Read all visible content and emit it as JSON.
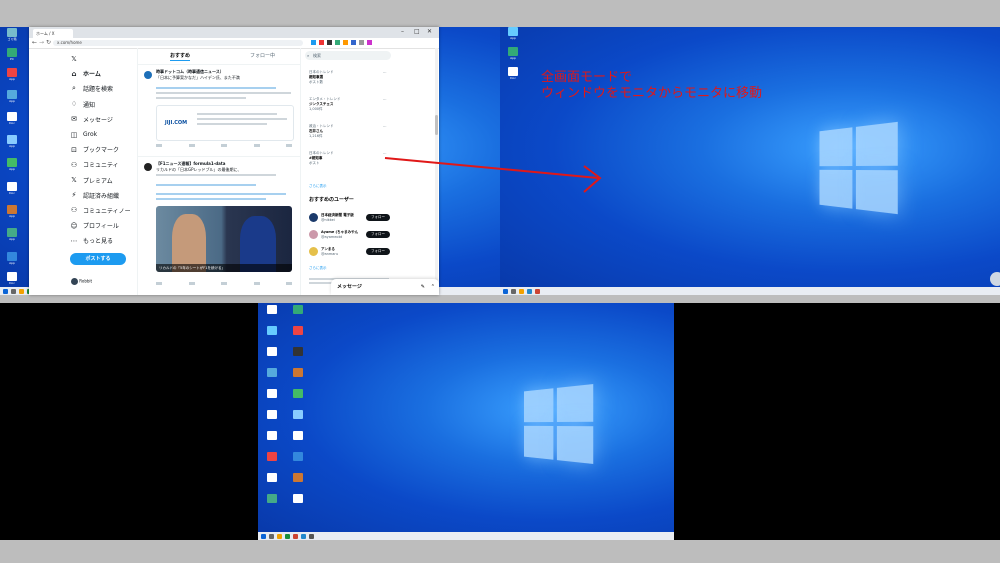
{
  "annotation": {
    "line1": "全画面モードで",
    "line2": "ウィンドウをモニタからモニタに移動"
  },
  "browser": {
    "tab_title": "ホーム / X",
    "url": "x.com/home",
    "nav": [
      {
        "icon": "𝕏",
        "label": ""
      },
      {
        "icon": "⌂",
        "label": "ホーム"
      },
      {
        "icon": "⌕",
        "label": "話題を検索"
      },
      {
        "icon": "♢",
        "label": "通知"
      },
      {
        "icon": "✉",
        "label": "メッセージ"
      },
      {
        "icon": "◫",
        "label": "Grok"
      },
      {
        "icon": "⊡",
        "label": "ブックマーク"
      },
      {
        "icon": "⚇",
        "label": "コミュニティ"
      },
      {
        "icon": "𝕏",
        "label": "プレミアム"
      },
      {
        "icon": "⚡",
        "label": "認証済み組織"
      },
      {
        "icon": "⚇",
        "label": "コミュニティノー"
      },
      {
        "icon": "☺",
        "label": "プロフィール"
      },
      {
        "icon": "⋯",
        "label": "もっと見る"
      }
    ],
    "post_button": "ポストする",
    "account_name": "Robbit",
    "feed_tabs": {
      "for_you": "おすすめ",
      "following": "フォロー中"
    },
    "post1": {
      "author": "時事ドットコム（時事通信ニュース）",
      "line1": "「日本に予算案かなだ」ハイデン氏、また不満",
      "card_title": "JIJI.COM"
    },
    "post2": {
      "author": "【F1ニュース速報】formula1-data",
      "line1": "リカルドの「日本GPレッドブル」の最後期に、",
      "image_caption": "リカルドの「5年のシートがF1を続ける」"
    },
    "search_placeholder": "検索",
    "trends": [
      {
        "meta": "日本のトレンド",
        "name": "都知事選",
        "count": "ポスト数"
      },
      {
        "meta": "エンタメ・トレンド",
        "name": "ジンクスチェス",
        "count": "1,000件"
      },
      {
        "meta": "政治・トレンド",
        "name": "石井さん",
        "count": "1,216件"
      },
      {
        "meta": "日本のトレンド",
        "name": "#都知事",
        "count": "ポスト"
      }
    ],
    "show_more": "さらに表示",
    "recommended_title": "おすすめのユーザー",
    "recommended": [
      {
        "name": "日本経済新聞 電子版",
        "handle": "@nikkei"
      },
      {
        "name": "Ayame (ちゃまみやん",
        "handle": "@ayameobt"
      },
      {
        "name": "アンまる",
        "handle": "@anmaru"
      }
    ],
    "follow_label": "フォロー",
    "messages_label": "メッセージ"
  },
  "colors": {
    "accent": "#1d9bf0",
    "annotation": "#e01818",
    "wallpaper": "#0b49c8"
  }
}
